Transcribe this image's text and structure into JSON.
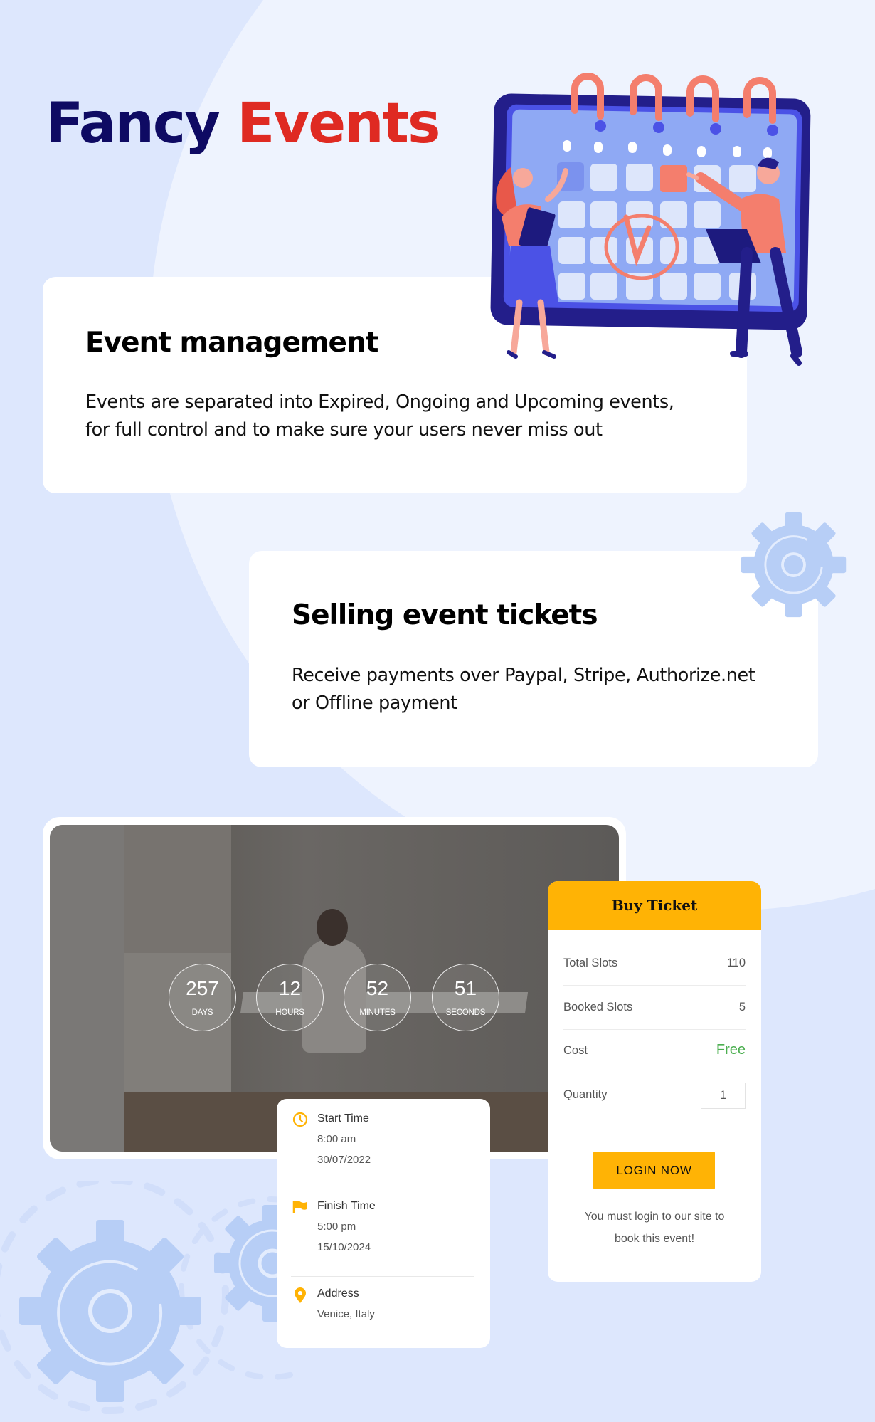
{
  "title": {
    "part1": "Fancy",
    "part2": "Events",
    "part1_color": "#0E0A63",
    "part2_color": "#DF2A22"
  },
  "features": [
    {
      "heading": "Event management",
      "body_line1": "Events are separated into Expired, Ongoing and Upcoming events,",
      "body_line2": "for full control and to make sure your users never miss out"
    },
    {
      "heading": "Selling event tickets",
      "body_line1": "Receive payments over Paypal, Stripe, Authorize.net",
      "body_line2": "or Offline payment"
    }
  ],
  "illustration": {
    "icon": "calendar-illustration",
    "description": "Two people pointing at a large calendar"
  },
  "countdown": [
    {
      "value": "257",
      "unit": "DAYS"
    },
    {
      "value": "12",
      "unit": "HOURS"
    },
    {
      "value": "52",
      "unit": "MINUTES"
    },
    {
      "value": "51",
      "unit": "SECONDS"
    }
  ],
  "event_info": {
    "start": {
      "icon": "clock-icon",
      "label": "Start Time",
      "time": "8:00 am",
      "date": "30/07/2022"
    },
    "finish": {
      "icon": "flag-icon",
      "label": "Finish Time",
      "time": "5:00 pm",
      "date": "15/10/2024"
    },
    "address": {
      "icon": "map-pin-icon",
      "label": "Address",
      "value": "Venice, Italy"
    }
  },
  "buy_ticket": {
    "title": "Buy Ticket",
    "rows": [
      {
        "label": "Total Slots",
        "value": "110"
      },
      {
        "label": "Booked Slots",
        "value": "5"
      },
      {
        "label": "Cost",
        "value": "Free"
      },
      {
        "label": "Quantity",
        "value": "1"
      }
    ],
    "login_button": "LOGIN NOW",
    "note_line1": "You must login to our site to",
    "note_line2": "book this event!",
    "accent_color": "#FFB305",
    "free_color": "#4CAF50"
  },
  "colors": {
    "background": "#DDE7FD",
    "background_light": "#EEF3FE",
    "gear": "#B7CEF6"
  }
}
